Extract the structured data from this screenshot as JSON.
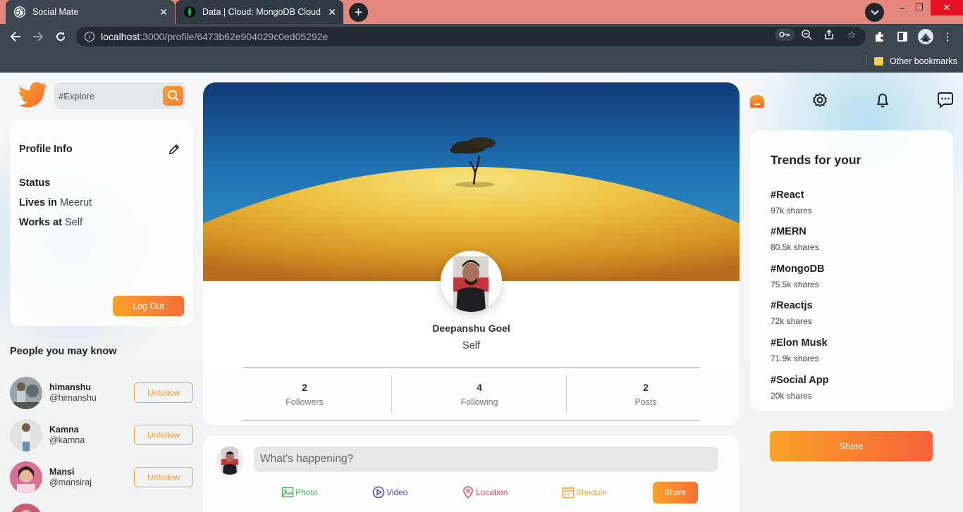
{
  "browser": {
    "tabs": [
      {
        "title": "Social Mate",
        "active": true
      },
      {
        "title": "Data | Cloud: MongoDB Cloud",
        "active": false
      }
    ],
    "url_host": "localhost",
    "url_path": ":3000/profile/6473b62e904029c0ed05292e",
    "bookmark_folder": "Other bookmarks",
    "tabbar_color": "#e5877c",
    "toolbar_color": "#3b4650"
  },
  "app": {
    "search": {
      "placeholder": "#Explore"
    },
    "profile_info": {
      "title": "Profile Info",
      "status_label": "Status",
      "lives_label": "Lives in",
      "lives_value": "Meerut",
      "works_label": "Works at",
      "works_value": "Self",
      "logout_label": "Log Out"
    },
    "people": {
      "title": "People you may know",
      "list": [
        {
          "name": "himanshu",
          "handle": "@himanshu",
          "action": "Unfollow"
        },
        {
          "name": "Kamna",
          "handle": "@kamna",
          "action": "Unfollow"
        },
        {
          "name": "Mansi",
          "handle": "@mansiraj",
          "action": "Unfollow"
        }
      ]
    },
    "profile": {
      "name": "Deepanshu Goel",
      "work": "Self",
      "stats": [
        {
          "value": "2",
          "label": "Followers"
        },
        {
          "value": "4",
          "label": "Following"
        },
        {
          "value": "2",
          "label": "Posts"
        }
      ]
    },
    "post": {
      "placeholder": "What's happening?",
      "options": [
        "Photo",
        "Video",
        "Location",
        "Shedule"
      ],
      "share_label": "Share"
    },
    "trends": {
      "title": "Trends for your",
      "items": [
        {
          "tag": "#React",
          "shares": "97k shares"
        },
        {
          "tag": "#MERN",
          "shares": "80.5k shares"
        },
        {
          "tag": "#MongoDB",
          "shares": "75.5k shares"
        },
        {
          "tag": "#Reactjs",
          "shares": "72k shares"
        },
        {
          "tag": "#Elon Musk",
          "shares": "71.9k shares"
        },
        {
          "tag": "#Social App",
          "shares": "20k shares"
        }
      ]
    },
    "share_button": "Share",
    "accent": "#f8902e",
    "icons": [
      "twitter-logo",
      "search-icon",
      "edit-icon",
      "home-icon",
      "gear-icon",
      "bell-icon",
      "chat-icon",
      "photo-icon",
      "video-icon",
      "location-icon",
      "calendar-icon"
    ]
  }
}
